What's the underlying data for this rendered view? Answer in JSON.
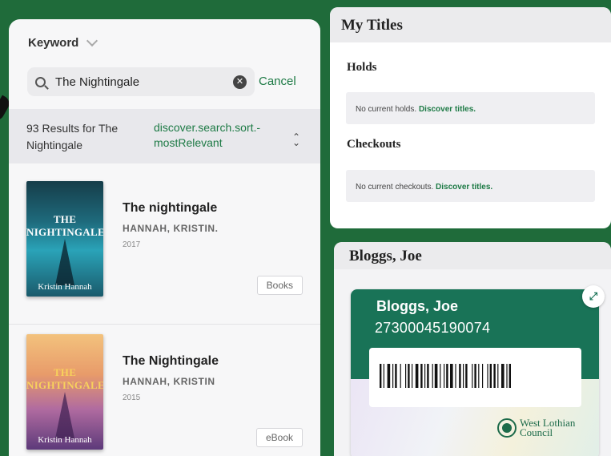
{
  "search": {
    "field_label": "Keyword",
    "query": "The Nightingale",
    "cancel_label": "Cancel",
    "results_label": "93 Results for The Nightingale",
    "sort_label": "discover.search.sort.-mostRelevant"
  },
  "books": [
    {
      "title": "The nightingale",
      "author": "HANNAH, KRISTIN.",
      "year": "2017",
      "format": "Books",
      "cover_title": "THE NIGHTINGALE",
      "cover_author": "Kristin Hannah"
    },
    {
      "title": "The Nightingale",
      "author": "HANNAH, KRISTIN",
      "year": "2015",
      "format": "eBook",
      "cover_title": "THE NIGHTINGALE",
      "cover_author": "Kristin Hannah"
    }
  ],
  "my_titles": {
    "heading": "My Titles",
    "holds": {
      "title": "Holds",
      "empty_text": "No current holds.",
      "link": "Discover titles."
    },
    "checkouts": {
      "title": "Checkouts",
      "empty_text": "No current checkouts.",
      "link": "Discover titles."
    }
  },
  "library_card": {
    "heading": "Bloggs, Joe",
    "name": "Bloggs, Joe",
    "number": "27300045190074",
    "issuer": "West Lothian Council",
    "issuer_line1": "West Lothian",
    "issuer_line2": "Council"
  },
  "colors": {
    "background": "#1f6b3a",
    "accent": "#1d7a45",
    "card": "#197357"
  }
}
